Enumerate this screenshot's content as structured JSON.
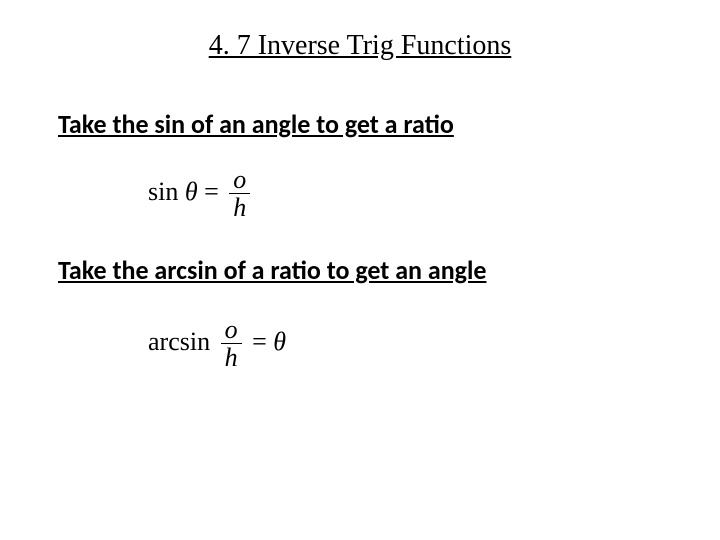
{
  "title": "4. 7 Inverse Trig Functions",
  "line1": "Take the sin of an angle to get a ratio",
  "line2": "Take the arcsin of a ratio to get an angle",
  "eq1": {
    "fn": "sin",
    "arg": "θ",
    "eq": "=",
    "num": "o",
    "den": "h"
  },
  "eq2": {
    "fn": "arcsin",
    "num": "o",
    "den": "h",
    "eq": "=",
    "res": "θ"
  }
}
